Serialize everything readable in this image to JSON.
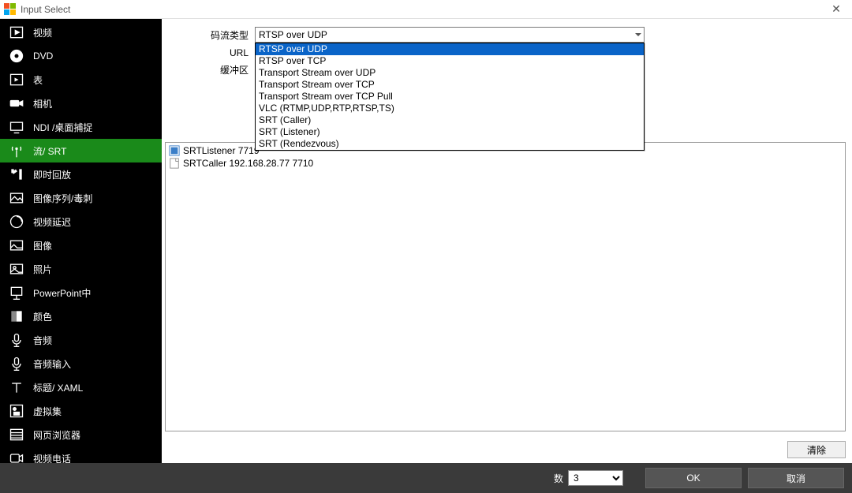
{
  "window": {
    "title": "Input Select"
  },
  "sidebar": {
    "items": [
      {
        "label": "视频",
        "icon": "video"
      },
      {
        "label": "DVD",
        "icon": "disc"
      },
      {
        "label": "表",
        "icon": "playlist"
      },
      {
        "label": "相机",
        "icon": "camera"
      },
      {
        "label": "NDI /桌面捕捉",
        "icon": "monitor"
      },
      {
        "label": "流/ SRT",
        "icon": "antenna",
        "active": true
      },
      {
        "label": "即时回放",
        "icon": "replay"
      },
      {
        "label": "图像序列/毒刺",
        "icon": "imageseq"
      },
      {
        "label": "视频延迟",
        "icon": "delay"
      },
      {
        "label": "图像",
        "icon": "image"
      },
      {
        "label": "照片",
        "icon": "photo"
      },
      {
        "label": "PowerPoint中",
        "icon": "ppt"
      },
      {
        "label": "颜色",
        "icon": "color"
      },
      {
        "label": "音频",
        "icon": "mic"
      },
      {
        "label": "音频输入",
        "icon": "micin"
      },
      {
        "label": "标题/ XAML",
        "icon": "title"
      },
      {
        "label": "虚拟集",
        "icon": "virtualset"
      },
      {
        "label": "网页浏览器",
        "icon": "browser"
      },
      {
        "label": "视频电话",
        "icon": "videocall"
      }
    ]
  },
  "form": {
    "stream_type_label": "码流类型",
    "url_label": "URL",
    "buffer_label": "缓冲区",
    "stream_type_value": "RTSP over UDP",
    "dropdown_options": [
      "RTSP over UDP",
      "RTSP over TCP",
      "Transport Stream over UDP",
      "Transport Stream over TCP",
      "Transport Stream over TCP Pull",
      "VLC (RTMP,UDP,RTP,RTSP,TS)",
      "SRT (Caller)",
      "SRT (Listener)",
      "SRT (Rendezvous)"
    ],
    "selected_index": 0
  },
  "list": {
    "items": [
      {
        "label": "SRTListener  7719",
        "type": "stream"
      },
      {
        "label": "SRTCaller 192.168.28.77 7710",
        "type": "file"
      }
    ]
  },
  "buttons": {
    "clear": "清除",
    "ok": "OK",
    "cancel": "取消"
  },
  "bottom": {
    "num_label": "数",
    "num_value": "3"
  }
}
